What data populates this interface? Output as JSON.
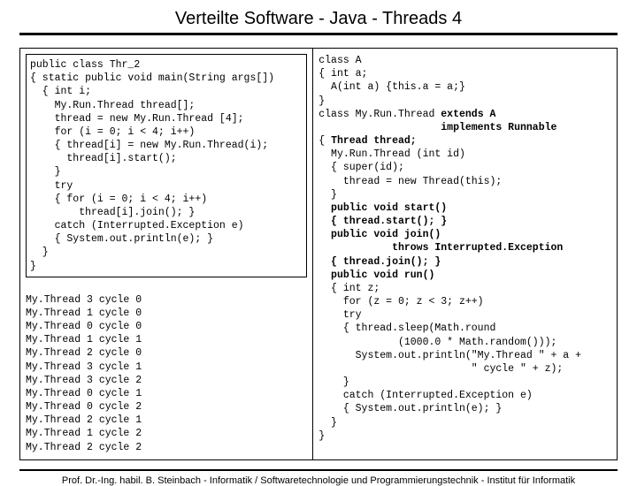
{
  "title": "Verteilte Software - Java - Threads 4",
  "left": {
    "code": "public class Thr_2\n{ static public void main(String args[])\n  { int i;\n    My.Run.Thread thread[];\n    thread = new My.Run.Thread [4];\n    for (i = 0; i < 4; i++)\n    { thread[i] = new My.Run.Thread(i);\n      thread[i].start();\n    }\n    try\n    { for (i = 0; i < 4; i++)\n        thread[i].join(); }\n    catch (Interrupted.Exception e)\n    { System.out.println(e); }\n  }\n}",
    "output": "My.Thread 3 cycle 0\nMy.Thread 1 cycle 0\nMy.Thread 0 cycle 0\nMy.Thread 1 cycle 1\nMy.Thread 2 cycle 0\nMy.Thread 3 cycle 1\nMy.Thread 3 cycle 2\nMy.Thread 0 cycle 1\nMy.Thread 0 cycle 2\nMy.Thread 2 cycle 1\nMy.Thread 1 cycle 2\nMy.Thread 2 cycle 2"
  },
  "right": {
    "codeA": "class A\n{ int a;\n  A(int a) {this.a = a;}\n}",
    "codeB_head": "class My.Run.Thread ",
    "codeB_extends": "extends A",
    "codeB_implements": "                    implements Runnable",
    "codeB_l1": "{ ",
    "codeB_thread_decl": "Thread thread;",
    "codeB_ctor": "  My.Run.Thread (int id)\n  { super(id);\n    thread = new Thread(this);\n  }",
    "codeB_start_sig": "  public void start()",
    "codeB_start_body": "  { thread.start(); }",
    "codeB_join_sig": "  public void join()",
    "codeB_join_throws": "            throws Interrupted.Exception",
    "codeB_join_body": "  { thread.join(); }",
    "codeB_run_sig": "  public void run()",
    "codeB_run_body": "  { int z;\n    for (z = 0; z < 3; z++)\n    try\n    { thread.sleep(Math.round\n             (1000.0 * Math.random()));\n      System.out.println(\"My.Thread \" + a +\n                         \" cycle \" + z);\n    }\n    catch (Interrupted.Exception e)\n    { System.out.println(e); }\n  }\n}"
  },
  "footer": "Prof. Dr.-Ing. habil. B. Steinbach - Informatik / Softwaretechnologie und Programmierungstechnik - Institut für Informatik"
}
